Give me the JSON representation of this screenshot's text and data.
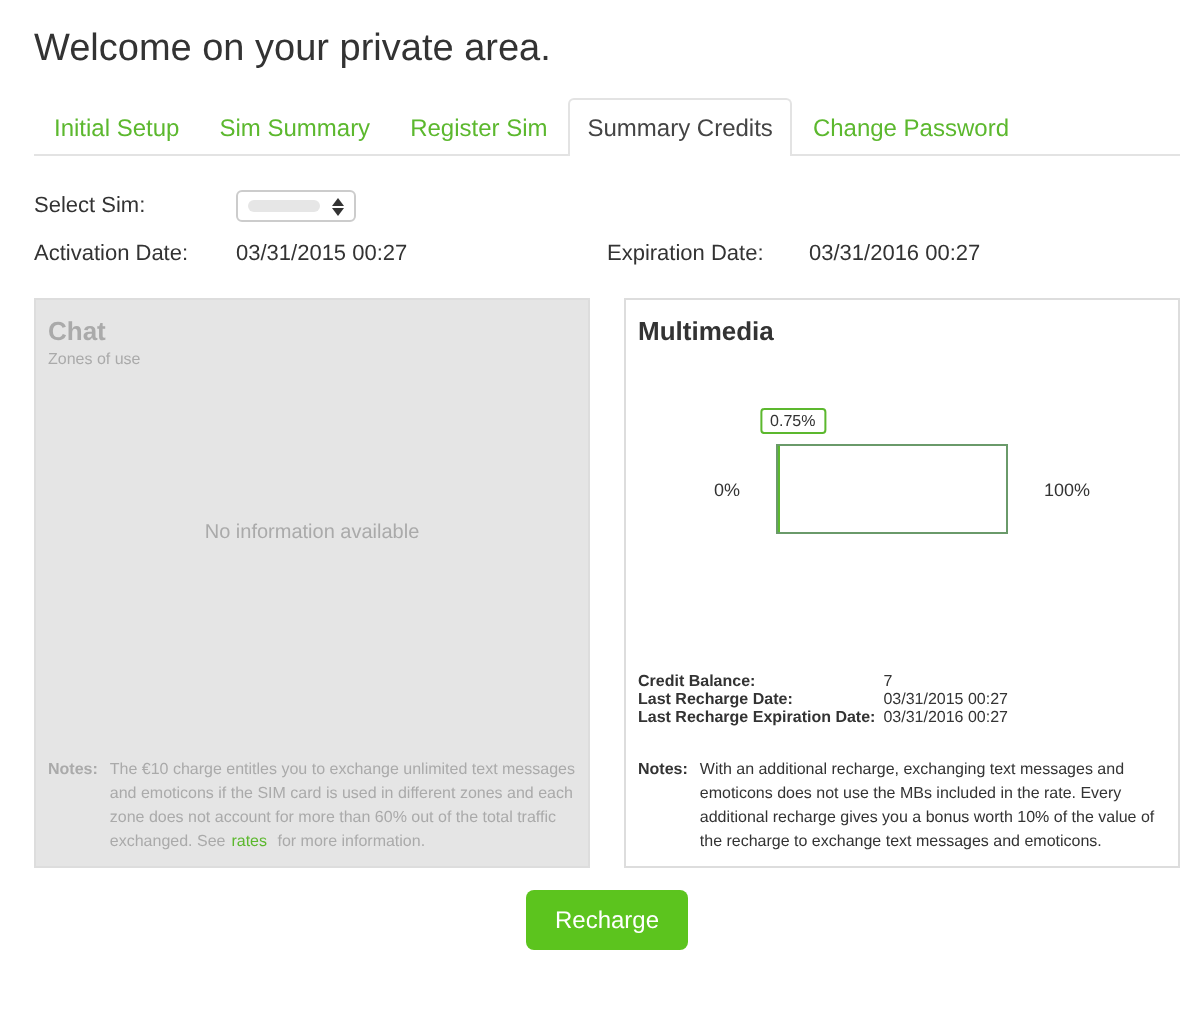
{
  "title": "Welcome on your private area.",
  "tabs": [
    {
      "label": "Initial Setup",
      "selected": false
    },
    {
      "label": "Sim Summary",
      "selected": false
    },
    {
      "label": "Register Sim",
      "selected": false
    },
    {
      "label": "Summary Credits",
      "selected": true
    },
    {
      "label": "Change Password",
      "selected": false
    }
  ],
  "select_sim": {
    "label": "Select Sim:"
  },
  "dates": [
    {
      "label": "Activation Date:",
      "value": "03/31/2015 00:27"
    },
    {
      "label": "Expiration Date:",
      "value": "03/31/2016 00:27"
    }
  ],
  "panels": [
    {
      "title": "Chat",
      "subtitle": "Zones of use",
      "disabled": true,
      "message": "No information available",
      "notes_label": "Notes:",
      "notes_before": "The €10 charge entitles you to exchange unlimited text messages and emoticons if the SIM card is used in different zones and each zone does not account for more than 60% out of the total traffic exchanged. See",
      "notes_link": "rates",
      "notes_after": "for more information."
    },
    {
      "title": "Multimedia",
      "disabled": false,
      "gauge": {
        "level": 0.0075,
        "reading": "0.75%",
        "min_label": "0%",
        "max_label": "100%"
      },
      "details": [
        {
          "label": "Credit Balance:",
          "value": "7"
        },
        {
          "label": "Last Recharge Date:",
          "value": "03/31/2015 00:27"
        },
        {
          "label": "Last Recharge Expiration Date:",
          "value": "03/31/2016 00:27"
        }
      ],
      "notes_label": "Notes:",
      "notes_before": "With an additional recharge, exchanging text messages and emoticons does not use the MBs included in the rate. Every additional recharge gives you a bonus worth 10% of the value of the recharge to exchange text messages and emoticons."
    }
  ],
  "button": "Recharge"
}
